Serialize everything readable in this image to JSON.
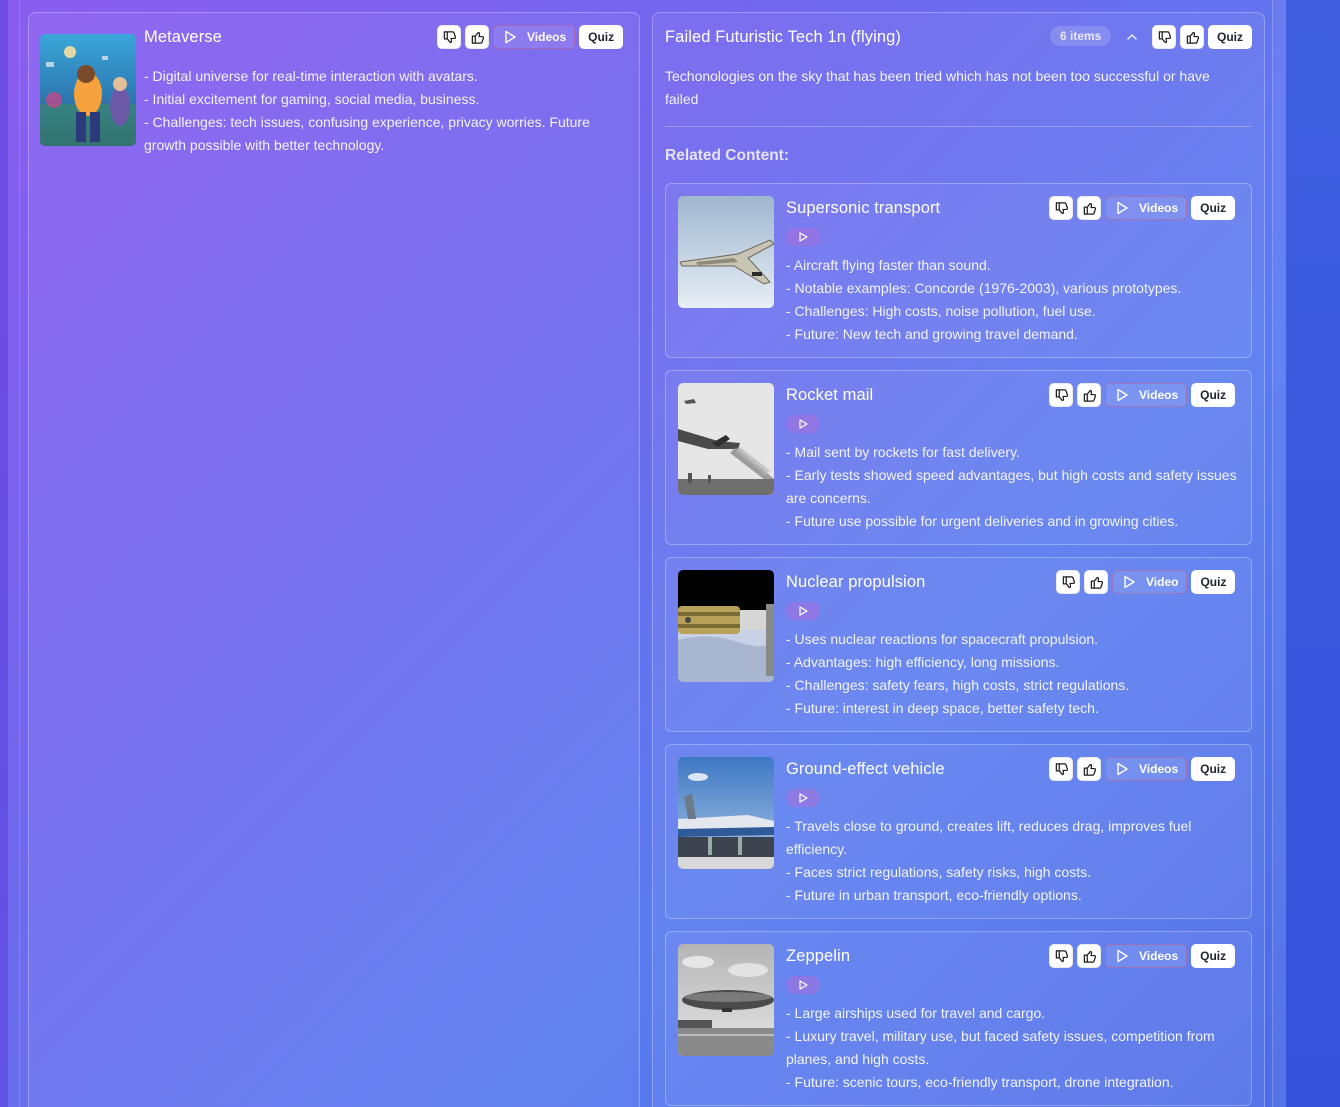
{
  "main_topic": {
    "title": "Metaverse",
    "bullets": [
      "- Digital universe for real-time interaction with avatars.",
      "- Initial excitement for gaming, social media, business.",
      "- Challenges: tech issues, confusing experience, privacy worries. Future growth possible with better technology."
    ],
    "videos_label": "Videos",
    "quiz_label": "Quiz"
  },
  "category": {
    "title": "Failed Futuristic Tech 1n (flying)",
    "item_count": "6 items",
    "description": "Techonologies on the sky that has been tried which has not been too successful or have failed",
    "quiz_label": "Quiz",
    "related_label": "Related Content:"
  },
  "items": [
    {
      "title": "Supersonic transport",
      "videos_label": "Videos",
      "quiz_label": "Quiz",
      "bullets": [
        "- Aircraft flying faster than sound.",
        "- Notable examples: Concorde (1976-2003), various prototypes.",
        "- Challenges: High costs, noise pollution, fuel use.",
        "- Future: New tech and growing travel demand."
      ]
    },
    {
      "title": "Rocket mail",
      "videos_label": "Videos",
      "quiz_label": "Quiz",
      "bullets": [
        "- Mail sent by rockets for fast delivery.",
        "- Early tests showed speed advantages, but high costs and safety issues are concerns.",
        "- Future use possible for urgent deliveries and in growing cities."
      ]
    },
    {
      "title": "Nuclear propulsion",
      "videos_label": "Video",
      "quiz_label": "Quiz",
      "bullets": [
        "- Uses nuclear reactions for spacecraft propulsion.",
        "- Advantages: high efficiency, long missions.",
        "- Challenges: safety fears, high costs, strict regulations.",
        "- Future: interest in deep space, better safety tech."
      ]
    },
    {
      "title": "Ground-effect vehicle",
      "videos_label": "Videos",
      "quiz_label": "Quiz",
      "bullets": [
        "- Travels close to ground, creates lift, reduces drag, improves fuel efficiency.",
        "- Faces strict regulations, safety risks, high costs.",
        "- Future in urban transport, eco-friendly options."
      ]
    },
    {
      "title": "Zeppelin",
      "videos_label": "Videos",
      "quiz_label": "Quiz",
      "bullets": [
        "- Large airships used for travel and cargo.",
        "- Luxury travel, military use, but faced safety issues, competition from planes, and high costs.",
        "- Future: scenic tours, eco-friendly transport, drone integration."
      ]
    }
  ]
}
